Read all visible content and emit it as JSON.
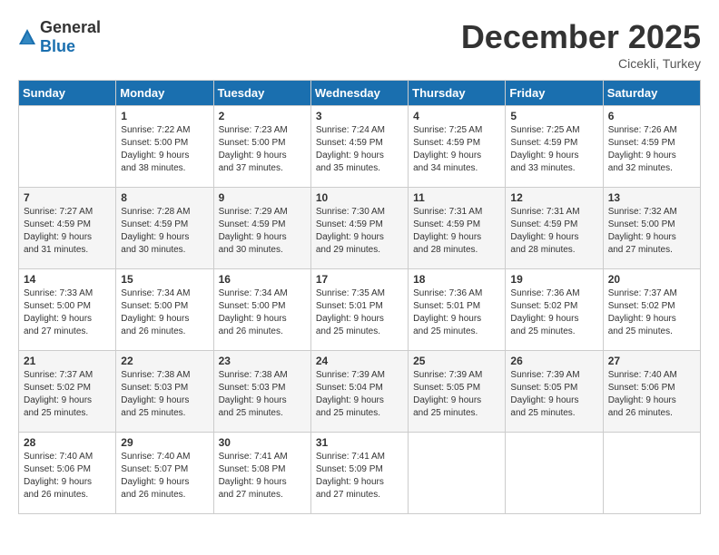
{
  "header": {
    "logo_general": "General",
    "logo_blue": "Blue",
    "month_title": "December 2025",
    "location": "Cicekli, Turkey"
  },
  "weekdays": [
    "Sunday",
    "Monday",
    "Tuesday",
    "Wednesday",
    "Thursday",
    "Friday",
    "Saturday"
  ],
  "weeks": [
    [
      {
        "day": "",
        "info": ""
      },
      {
        "day": "1",
        "info": "Sunrise: 7:22 AM\nSunset: 5:00 PM\nDaylight: 9 hours\nand 38 minutes."
      },
      {
        "day": "2",
        "info": "Sunrise: 7:23 AM\nSunset: 5:00 PM\nDaylight: 9 hours\nand 37 minutes."
      },
      {
        "day": "3",
        "info": "Sunrise: 7:24 AM\nSunset: 4:59 PM\nDaylight: 9 hours\nand 35 minutes."
      },
      {
        "day": "4",
        "info": "Sunrise: 7:25 AM\nSunset: 4:59 PM\nDaylight: 9 hours\nand 34 minutes."
      },
      {
        "day": "5",
        "info": "Sunrise: 7:25 AM\nSunset: 4:59 PM\nDaylight: 9 hours\nand 33 minutes."
      },
      {
        "day": "6",
        "info": "Sunrise: 7:26 AM\nSunset: 4:59 PM\nDaylight: 9 hours\nand 32 minutes."
      }
    ],
    [
      {
        "day": "7",
        "info": "Sunrise: 7:27 AM\nSunset: 4:59 PM\nDaylight: 9 hours\nand 31 minutes."
      },
      {
        "day": "8",
        "info": "Sunrise: 7:28 AM\nSunset: 4:59 PM\nDaylight: 9 hours\nand 30 minutes."
      },
      {
        "day": "9",
        "info": "Sunrise: 7:29 AM\nSunset: 4:59 PM\nDaylight: 9 hours\nand 30 minutes."
      },
      {
        "day": "10",
        "info": "Sunrise: 7:30 AM\nSunset: 4:59 PM\nDaylight: 9 hours\nand 29 minutes."
      },
      {
        "day": "11",
        "info": "Sunrise: 7:31 AM\nSunset: 4:59 PM\nDaylight: 9 hours\nand 28 minutes."
      },
      {
        "day": "12",
        "info": "Sunrise: 7:31 AM\nSunset: 4:59 PM\nDaylight: 9 hours\nand 28 minutes."
      },
      {
        "day": "13",
        "info": "Sunrise: 7:32 AM\nSunset: 5:00 PM\nDaylight: 9 hours\nand 27 minutes."
      }
    ],
    [
      {
        "day": "14",
        "info": "Sunrise: 7:33 AM\nSunset: 5:00 PM\nDaylight: 9 hours\nand 27 minutes."
      },
      {
        "day": "15",
        "info": "Sunrise: 7:34 AM\nSunset: 5:00 PM\nDaylight: 9 hours\nand 26 minutes."
      },
      {
        "day": "16",
        "info": "Sunrise: 7:34 AM\nSunset: 5:00 PM\nDaylight: 9 hours\nand 26 minutes."
      },
      {
        "day": "17",
        "info": "Sunrise: 7:35 AM\nSunset: 5:01 PM\nDaylight: 9 hours\nand 25 minutes."
      },
      {
        "day": "18",
        "info": "Sunrise: 7:36 AM\nSunset: 5:01 PM\nDaylight: 9 hours\nand 25 minutes."
      },
      {
        "day": "19",
        "info": "Sunrise: 7:36 AM\nSunset: 5:02 PM\nDaylight: 9 hours\nand 25 minutes."
      },
      {
        "day": "20",
        "info": "Sunrise: 7:37 AM\nSunset: 5:02 PM\nDaylight: 9 hours\nand 25 minutes."
      }
    ],
    [
      {
        "day": "21",
        "info": "Sunrise: 7:37 AM\nSunset: 5:02 PM\nDaylight: 9 hours\nand 25 minutes."
      },
      {
        "day": "22",
        "info": "Sunrise: 7:38 AM\nSunset: 5:03 PM\nDaylight: 9 hours\nand 25 minutes."
      },
      {
        "day": "23",
        "info": "Sunrise: 7:38 AM\nSunset: 5:03 PM\nDaylight: 9 hours\nand 25 minutes."
      },
      {
        "day": "24",
        "info": "Sunrise: 7:39 AM\nSunset: 5:04 PM\nDaylight: 9 hours\nand 25 minutes."
      },
      {
        "day": "25",
        "info": "Sunrise: 7:39 AM\nSunset: 5:05 PM\nDaylight: 9 hours\nand 25 minutes."
      },
      {
        "day": "26",
        "info": "Sunrise: 7:39 AM\nSunset: 5:05 PM\nDaylight: 9 hours\nand 25 minutes."
      },
      {
        "day": "27",
        "info": "Sunrise: 7:40 AM\nSunset: 5:06 PM\nDaylight: 9 hours\nand 26 minutes."
      }
    ],
    [
      {
        "day": "28",
        "info": "Sunrise: 7:40 AM\nSunset: 5:06 PM\nDaylight: 9 hours\nand 26 minutes."
      },
      {
        "day": "29",
        "info": "Sunrise: 7:40 AM\nSunset: 5:07 PM\nDaylight: 9 hours\nand 26 minutes."
      },
      {
        "day": "30",
        "info": "Sunrise: 7:41 AM\nSunset: 5:08 PM\nDaylight: 9 hours\nand 27 minutes."
      },
      {
        "day": "31",
        "info": "Sunrise: 7:41 AM\nSunset: 5:09 PM\nDaylight: 9 hours\nand 27 minutes."
      },
      {
        "day": "",
        "info": ""
      },
      {
        "day": "",
        "info": ""
      },
      {
        "day": "",
        "info": ""
      }
    ]
  ]
}
